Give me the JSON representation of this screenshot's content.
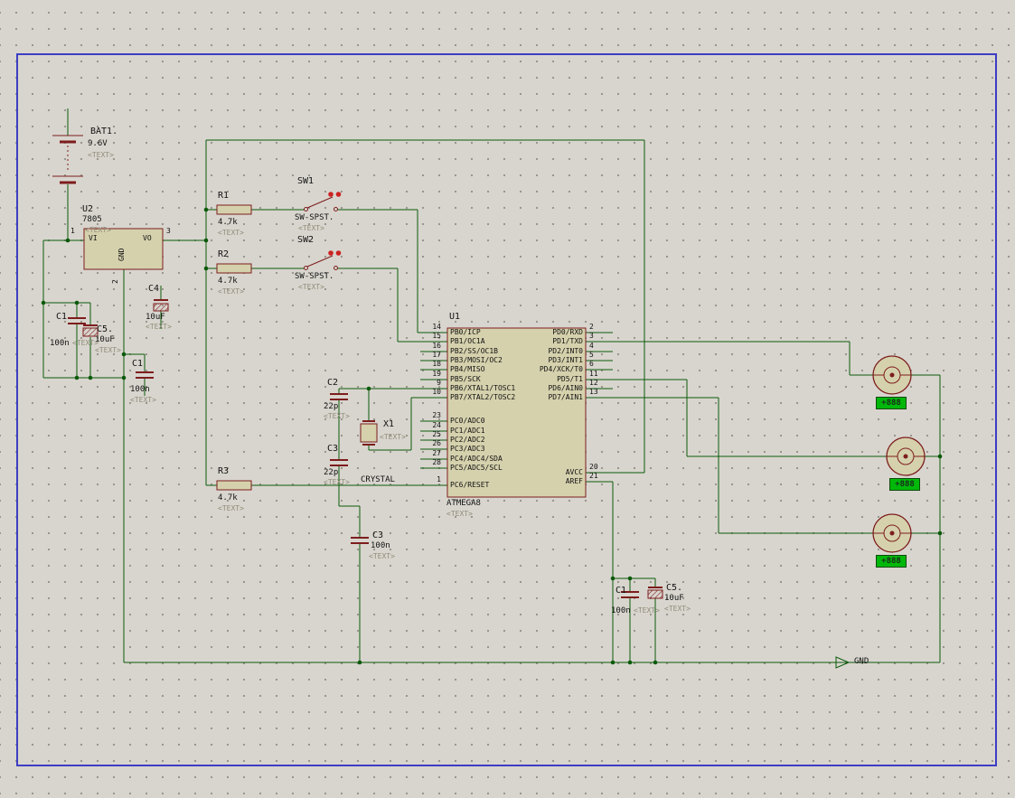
{
  "canvas": {
    "background": "#d8d5ce",
    "grid_dot_color": "#96938a",
    "sheet_border_color": "#3d3dc4",
    "wire_color": "#0b5a0b",
    "component_outline_color": "#7d1d1d",
    "component_fill_color": "#d5d1ad",
    "placeholder_color": "#908d7a",
    "switch_dot_color": "#cc2222",
    "display_bg_color": "#00b80a"
  },
  "net_labels": {
    "gnd": "GND"
  },
  "components": {
    "bat1": {
      "ref": "BAT1.",
      "value": "9.6V",
      "text": "<TEXT>"
    },
    "u2": {
      "ref": "U2",
      "value": "7805",
      "text": "<TEXT>",
      "pins": {
        "vi": {
          "num": "1",
          "name": "VI"
        },
        "vo": {
          "num": "3",
          "name": "VO"
        },
        "gnd": {
          "num": "2",
          "name": "GND"
        }
      }
    },
    "r1": {
      "ref": "R1",
      "value": "4.7k",
      "text": "<TEXT>"
    },
    "r2": {
      "ref": "R2",
      "value": "4.7k",
      "text": "<TEXT>"
    },
    "r3": {
      "ref": "R3",
      "value": "4.7k",
      "text": "<TEXT>"
    },
    "sw1": {
      "ref": "SW1",
      "value": "SW-SPST.",
      "text": "<TEXT>"
    },
    "sw2": {
      "ref": "SW2",
      "value": "SW-SPST.",
      "text": "<TEXT>"
    },
    "c1a": {
      "ref": "C1",
      "value": "100n",
      "text": "<TEXT>"
    },
    "c5a": {
      "ref": "C5.",
      "value": "10uF",
      "text": "<TEXT>"
    },
    "c4": {
      "ref": "C4",
      "value": "10uF",
      "text": "<TEXT>"
    },
    "c1b": {
      "ref": "C1",
      "value": "100n",
      "text": "<TEXT>"
    },
    "c2": {
      "ref": "C2",
      "value": "22p",
      "text": "<TEXT>"
    },
    "c3a": {
      "ref": "C3",
      "value": "22p",
      "text": "<TEXT>"
    },
    "x1": {
      "ref": "X1",
      "value": "CRYSTAL",
      "text": "<TEXT>"
    },
    "c3b": {
      "ref": "C3",
      "value": "100n",
      "text": "<TEXT>"
    },
    "c1c": {
      "ref": "C1",
      "value": "100n",
      "text": "<TEXT>"
    },
    "c5c": {
      "ref": "C5.",
      "value": "10uF",
      "text": "<TEXT>"
    },
    "u1": {
      "ref": "U1",
      "value": "ATMEGA8",
      "text": "<TEXT>",
      "left_pins": [
        {
          "num": "14",
          "name": "PB0/ICP"
        },
        {
          "num": "15",
          "name": "PB1/OC1A"
        },
        {
          "num": "16",
          "name": "PB2/SS/OC1B"
        },
        {
          "num": "17",
          "name": "PB3/MOSI/OC2"
        },
        {
          "num": "18",
          "name": "PB4/MISO"
        },
        {
          "num": "19",
          "name": "PB5/SCK"
        },
        {
          "num": "9",
          "name": "PB6/XTAL1/TOSC1"
        },
        {
          "num": "10",
          "name": "PB7/XTAL2/TOSC2"
        },
        {
          "num": "23",
          "name": "PC0/ADC0"
        },
        {
          "num": "24",
          "name": "PC1/ADC1"
        },
        {
          "num": "25",
          "name": "PC2/ADC2"
        },
        {
          "num": "26",
          "name": "PC3/ADC3"
        },
        {
          "num": "27",
          "name": "PC4/ADC4/SDA"
        },
        {
          "num": "28",
          "name": "PC5/ADC5/SCL"
        },
        {
          "num": "1",
          "name": "PC6/RESET"
        }
      ],
      "right_pins": [
        {
          "num": "2",
          "name": "PD0/RXD"
        },
        {
          "num": "3",
          "name": "PD1/TXD"
        },
        {
          "num": "4",
          "name": "PD2/INT0"
        },
        {
          "num": "5",
          "name": "PD3/INT1"
        },
        {
          "num": "6",
          "name": "PD4/XCK/T0"
        },
        {
          "num": "11",
          "name": "PD5/T1"
        },
        {
          "num": "12",
          "name": "PD6/AIN0"
        },
        {
          "num": "13",
          "name": "PD7/AIN1"
        },
        {
          "num": "20",
          "name": "AVCC"
        },
        {
          "num": "21",
          "name": "AREF"
        }
      ]
    },
    "motors": [
      {
        "display": "+888"
      },
      {
        "display": "+888"
      },
      {
        "display": "+888"
      }
    ]
  }
}
